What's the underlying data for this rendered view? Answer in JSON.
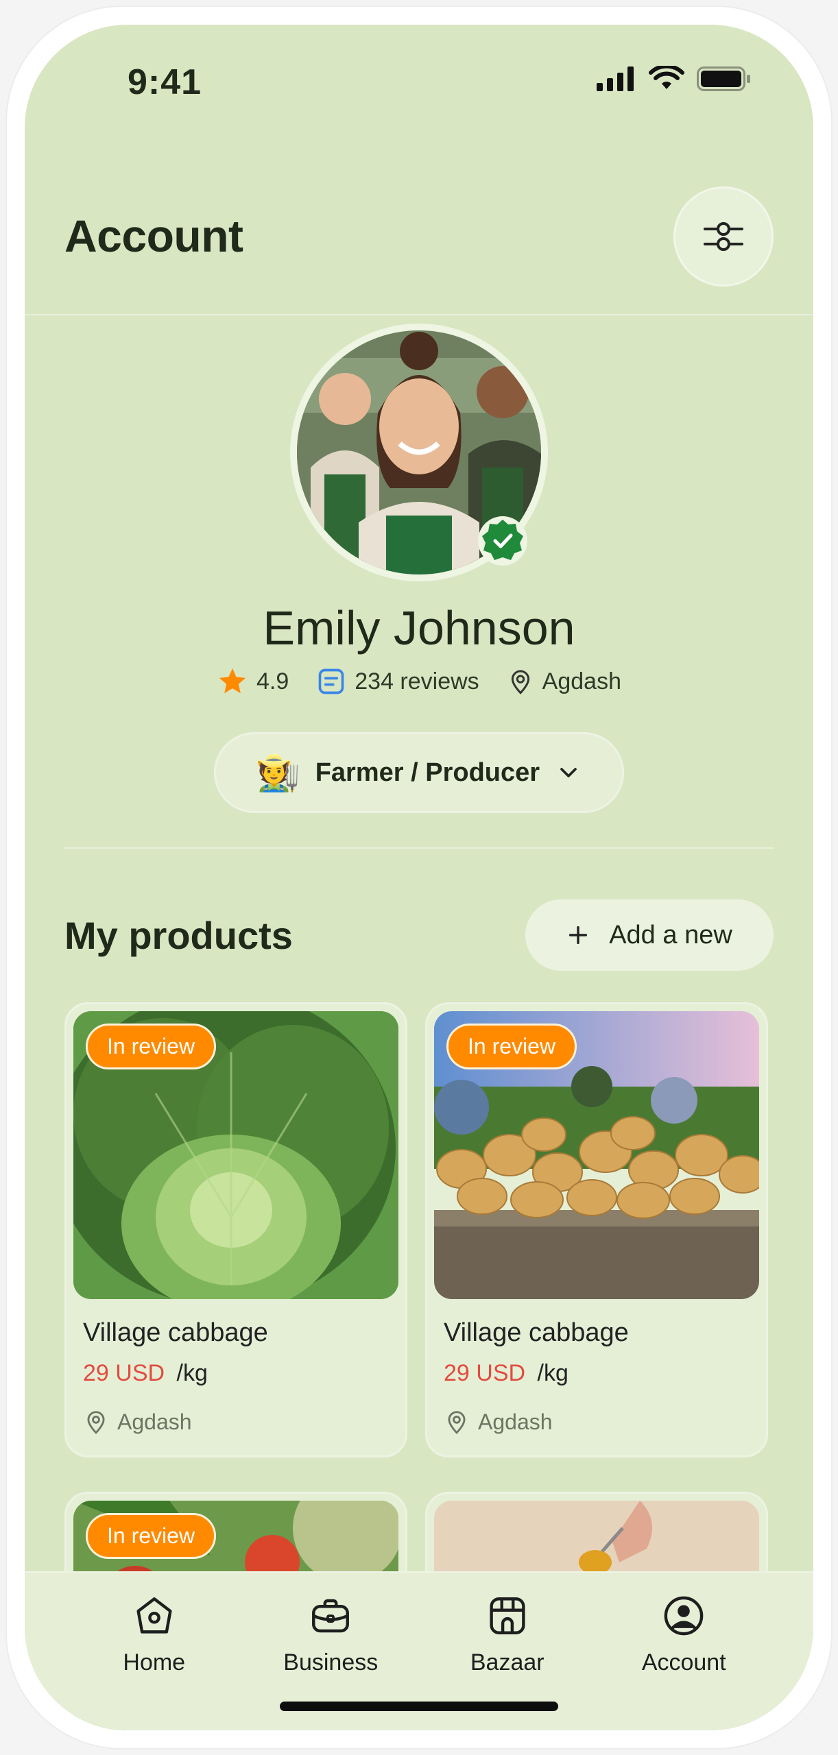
{
  "status_bar": {
    "time": "9:41"
  },
  "header": {
    "title": "Account"
  },
  "profile": {
    "name": "Emily Johnson",
    "rating": "4.9",
    "reviews": "234 reviews",
    "location": "Agdash",
    "role": "Farmer / Producer",
    "role_emoji": "🧑‍🌾"
  },
  "products_section": {
    "title": "My products",
    "add_label": "Add a new",
    "items": [
      {
        "tag": "In review",
        "title": "Village cabbage",
        "price": "29 USD",
        "unit": "/kg",
        "location": "Agdash"
      },
      {
        "tag": "In review",
        "title": "Village cabbage",
        "price": "29 USD",
        "unit": "/kg",
        "location": "Agdash"
      },
      {
        "tag": "In review",
        "title": "",
        "price": "",
        "unit": "",
        "location": ""
      },
      {
        "tag": "",
        "title": "",
        "price": "",
        "unit": "",
        "location": ""
      }
    ]
  },
  "bottom_nav": {
    "items": [
      {
        "label": "Home",
        "icon": "home-icon"
      },
      {
        "label": "Business",
        "icon": "briefcase-icon"
      },
      {
        "label": "Bazaar",
        "icon": "store-icon"
      },
      {
        "label": "Account",
        "icon": "user-circle-icon"
      }
    ]
  },
  "colors": {
    "background": "#d9e6c2",
    "tag": "#ff8a00",
    "price": "#e24b3e",
    "verified": "#1f8a3a",
    "star": "#ff8a00",
    "reviews_icon": "#3a86e8"
  }
}
